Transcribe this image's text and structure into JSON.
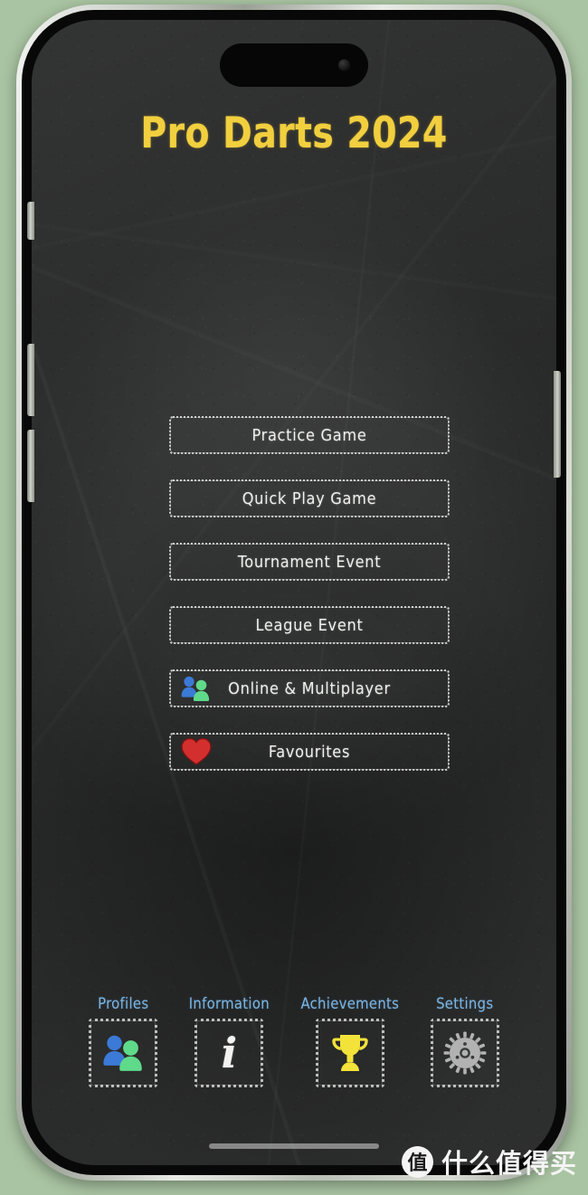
{
  "app": {
    "title": "Pro Darts 2024",
    "title_color": "#f1cf3e"
  },
  "menu": {
    "items": [
      {
        "label": "Practice Game",
        "icon": "none"
      },
      {
        "label": "Quick Play Game",
        "icon": "none"
      },
      {
        "label": "Tournament Event",
        "icon": "none"
      },
      {
        "label": "League Event",
        "icon": "none"
      },
      {
        "label": "Online & Multiplayer",
        "icon": "people-icon"
      },
      {
        "label": "Favourites",
        "icon": "heart-icon"
      }
    ]
  },
  "bottom_nav": {
    "label_color": "#79b6e6",
    "items": [
      {
        "label": "Profiles",
        "icon": "people-icon"
      },
      {
        "label": "Information",
        "icon": "info-icon",
        "glyph": "i"
      },
      {
        "label": "Achievements",
        "icon": "trophy-icon"
      },
      {
        "label": "Settings",
        "icon": "gear-icon"
      }
    ]
  },
  "colors": {
    "person_blue": "#3b7ad6",
    "person_green": "#5fd98a",
    "heart_red": "#d42f2f",
    "trophy_yellow": "#f2e23a",
    "gear_gray": "#b2b2b2",
    "board_dark": "#2b2c2c",
    "outside_green": "#a9c4a2"
  },
  "watermark": {
    "logo_char": "值",
    "text": "什么值得买"
  }
}
